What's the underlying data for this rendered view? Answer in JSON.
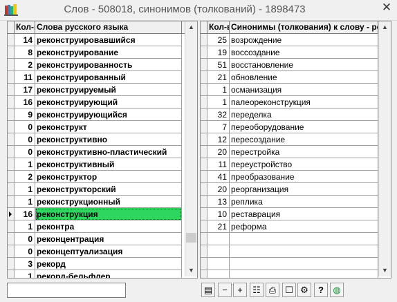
{
  "window": {
    "title": "Слов - 508018, синонимов (толкований) - 1898473",
    "close_glyph": "✕"
  },
  "left_grid": {
    "headers": {
      "count": "Кол-во",
      "word": "Слова русского языка"
    },
    "rows": [
      {
        "count": "14",
        "word": "реконструировавшийся"
      },
      {
        "count": "8",
        "word": "реконструирование"
      },
      {
        "count": "2",
        "word": "реконструированность"
      },
      {
        "count": "11",
        "word": "реконструированный"
      },
      {
        "count": "17",
        "word": "реконструируемый"
      },
      {
        "count": "16",
        "word": "реконструирующий"
      },
      {
        "count": "9",
        "word": "реконструирующийся"
      },
      {
        "count": "0",
        "word": "реконструкт"
      },
      {
        "count": "0",
        "word": "реконструктивно"
      },
      {
        "count": "0",
        "word": "реконструктивно-пластический"
      },
      {
        "count": "1",
        "word": "реконструктивный"
      },
      {
        "count": "2",
        "word": "реконструктор"
      },
      {
        "count": "1",
        "word": "реконструкторский"
      },
      {
        "count": "1",
        "word": "реконструкционный"
      },
      {
        "count": "16",
        "word": "реконструкция",
        "selected": true
      },
      {
        "count": "1",
        "word": "реконтра"
      },
      {
        "count": "0",
        "word": "реконцентрация"
      },
      {
        "count": "0",
        "word": "реконцептуализация"
      },
      {
        "count": "3",
        "word": "рекорд"
      },
      {
        "count": "1",
        "word": "рекорд-бельфлер"
      }
    ]
  },
  "right_grid": {
    "headers": {
      "count": "Кол-во",
      "synonym": "Синонимы (толкования) к слову  - реконструкция"
    },
    "rows": [
      {
        "count": "25",
        "synonym": "возрождение"
      },
      {
        "count": "19",
        "synonym": "воссоздание"
      },
      {
        "count": "51",
        "synonym": "восстановление"
      },
      {
        "count": "21",
        "synonym": "обновление"
      },
      {
        "count": "1",
        "synonym": "османизация"
      },
      {
        "count": "1",
        "synonym": "палеореконструкция"
      },
      {
        "count": "32",
        "synonym": "переделка"
      },
      {
        "count": "7",
        "synonym": "переоборудование"
      },
      {
        "count": "12",
        "synonym": "пересоздание"
      },
      {
        "count": "20",
        "synonym": "перестройка"
      },
      {
        "count": "11",
        "synonym": "переустройство"
      },
      {
        "count": "41",
        "synonym": "преобразование"
      },
      {
        "count": "20",
        "synonym": "реорганизация"
      },
      {
        "count": "13",
        "synonym": "реплика"
      },
      {
        "count": "10",
        "synonym": "реставрация"
      },
      {
        "count": "21",
        "synonym": "реформа"
      }
    ]
  },
  "left_scroll_position": 0.9,
  "statusbar": {
    "search_value": "",
    "toolbar_buttons": [
      {
        "name": "card-view-icon",
        "glyph": "▤"
      },
      {
        "name": "minus-icon",
        "glyph": "−"
      },
      {
        "name": "plus-icon",
        "glyph": "+"
      },
      {
        "name": "list-edit-icon",
        "glyph": "☷"
      },
      {
        "name": "print-icon",
        "glyph": "⎙"
      },
      {
        "name": "blank-page-icon",
        "glyph": "☐"
      },
      {
        "name": "settings-icon",
        "glyph": "⚙"
      },
      {
        "name": "help-icon",
        "glyph": "?"
      },
      {
        "name": "globe-icon",
        "glyph": "◍"
      }
    ]
  },
  "colors": {
    "selection": "#2ed65f",
    "header_bg": "#f0f0f0",
    "grid_line": "#a0a0a0"
  }
}
